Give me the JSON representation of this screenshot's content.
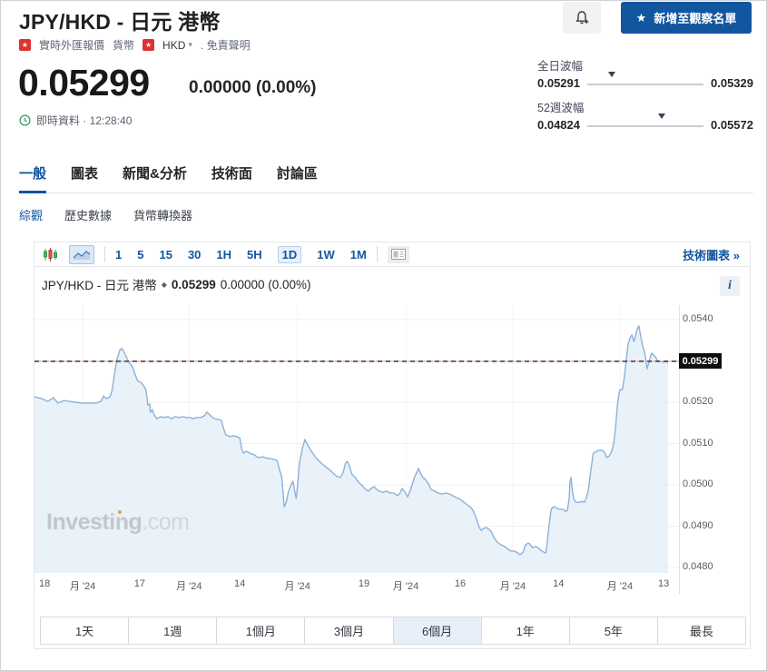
{
  "page": {
    "header": {
      "title": "JPY/HKD - 日元 港幣",
      "star": "★",
      "watchlist_label": "新增至觀察名單"
    },
    "breadcrumb": {
      "flag1": "★",
      "item1": "實時外匯報價",
      "item2": "貨幣",
      "flag2": "★",
      "pair": "HKD",
      "caret": "▾",
      "disclaimer": ". 免責聲明"
    },
    "quote": {
      "price": "0.05299",
      "change": "0.00000 (0.00%)",
      "realtime": "即時資料 · 12:28:40"
    },
    "ranges": {
      "day": {
        "label": "全日波幅",
        "low": "0.05291",
        "high": "0.05329",
        "pos": 0.21
      },
      "year": {
        "label": "52週波幅",
        "low": "0.04824",
        "high": "0.05572",
        "pos": 0.64
      }
    },
    "tabs": {
      "t0": "一般",
      "t1": "圖表",
      "t2": "新聞&分析",
      "t3": "技術面",
      "t4": "討論區"
    },
    "subnav": {
      "s0": "綜觀",
      "s1": "歷史數據",
      "s2": "貨幣轉換器"
    },
    "toolbar": {
      "i0": "1",
      "i1": "5",
      "i2": "15",
      "i3": "30",
      "i4": "1H",
      "i5": "5H",
      "i6": "1D",
      "i7": "1W",
      "i8": "1M",
      "link": "技術圖表 »"
    },
    "chart_header": {
      "name": "JPY/HKD - 日元 港幣",
      "diamond": "◆",
      "price": "0.05299",
      "change": "0.00000 (0.00%)",
      "info": "i"
    },
    "watermark": {
      "bold": "Investing",
      "light": ".com"
    },
    "footer": {
      "b0": "1天",
      "b1": "1週",
      "b2": "1個月",
      "b3": "3個月",
      "b4": "6個月",
      "b5": "1年",
      "b6": "5年",
      "b7": "最長"
    }
  },
  "colors": {
    "accent": "#1256a0",
    "line": "#8cb2d7",
    "fill": "#e7f0f8",
    "grid_h": "#eff1f2",
    "grid_v": "#f4f5f6",
    "dash_base": "#f2a5a5",
    "dash": "#2a2a2a",
    "badge_bg": "#0d0e10",
    "up_green": "#35a04c",
    "down_red": "#d23f3f"
  },
  "chart_data": {
    "type": "area",
    "title": "JPY/HKD 1D (6個月)",
    "ylabel": "",
    "xlabel": "",
    "ylim": [
      0.04787,
      0.05435
    ],
    "current_price": 0.05299,
    "current_price_label": "0.05299",
    "y_ticks": [
      {
        "v": 0.054,
        "label": "0.0540"
      },
      {
        "v": 0.053,
        "label": "0.0530"
      },
      {
        "v": 0.052,
        "label": "0.0520"
      },
      {
        "v": 0.051,
        "label": "0.0510"
      },
      {
        "v": 0.05,
        "label": "0.0500"
      },
      {
        "v": 0.049,
        "label": "0.0490"
      },
      {
        "v": 0.048,
        "label": "0.0480"
      }
    ],
    "x_ticks": [
      {
        "f": 0.016,
        "label": "18",
        "month": false
      },
      {
        "f": 0.076,
        "label": "月 '24",
        "month": true
      },
      {
        "f": 0.166,
        "label": "17",
        "month": false
      },
      {
        "f": 0.244,
        "label": "月 '24",
        "month": true
      },
      {
        "f": 0.324,
        "label": "14",
        "month": false
      },
      {
        "f": 0.415,
        "label": "月 '24",
        "month": true
      },
      {
        "f": 0.52,
        "label": "19",
        "month": false
      },
      {
        "f": 0.586,
        "label": "月 '24",
        "month": true
      },
      {
        "f": 0.672,
        "label": "16",
        "month": false
      },
      {
        "f": 0.755,
        "label": "月 '24",
        "month": true
      },
      {
        "f": 0.827,
        "label": "14",
        "month": false
      },
      {
        "f": 0.924,
        "label": "月 '24",
        "month": true
      },
      {
        "f": 0.993,
        "label": "13",
        "month": false
      }
    ],
    "points": [
      [
        0.0,
        0.05213
      ],
      [
        0.011,
        0.05209
      ],
      [
        0.021,
        0.05202
      ],
      [
        0.03,
        0.05211
      ],
      [
        0.037,
        0.05198
      ],
      [
        0.047,
        0.05204
      ],
      [
        0.056,
        0.05202
      ],
      [
        0.064,
        0.052
      ],
      [
        0.076,
        0.05198
      ],
      [
        0.087,
        0.05198
      ],
      [
        0.097,
        0.05198
      ],
      [
        0.105,
        0.05202
      ],
      [
        0.109,
        0.05215
      ],
      [
        0.113,
        0.05209
      ],
      [
        0.119,
        0.05213
      ],
      [
        0.122,
        0.05226
      ],
      [
        0.126,
        0.05264
      ],
      [
        0.13,
        0.05303
      ],
      [
        0.135,
        0.05327
      ],
      [
        0.138,
        0.0533
      ],
      [
        0.142,
        0.05319
      ],
      [
        0.146,
        0.05306
      ],
      [
        0.15,
        0.05295
      ],
      [
        0.155,
        0.05284
      ],
      [
        0.159,
        0.05266
      ],
      [
        0.163,
        0.05251
      ],
      [
        0.168,
        0.05248
      ],
      [
        0.172,
        0.0524
      ],
      [
        0.176,
        0.05231
      ],
      [
        0.179,
        0.05193
      ],
      [
        0.182,
        0.05196
      ],
      [
        0.183,
        0.05176
      ],
      [
        0.186,
        0.05182
      ],
      [
        0.189,
        0.05169
      ],
      [
        0.193,
        0.0516
      ],
      [
        0.199,
        0.05165
      ],
      [
        0.205,
        0.05163
      ],
      [
        0.211,
        0.05165
      ],
      [
        0.216,
        0.0516
      ],
      [
        0.222,
        0.05165
      ],
      [
        0.228,
        0.05163
      ],
      [
        0.234,
        0.05165
      ],
      [
        0.239,
        0.05163
      ],
      [
        0.245,
        0.05163
      ],
      [
        0.251,
        0.0516
      ],
      [
        0.256,
        0.05163
      ],
      [
        0.262,
        0.05163
      ],
      [
        0.268,
        0.05167
      ],
      [
        0.272,
        0.05176
      ],
      [
        0.277,
        0.05169
      ],
      [
        0.281,
        0.05163
      ],
      [
        0.285,
        0.0516
      ],
      [
        0.291,
        0.05158
      ],
      [
        0.295,
        0.05156
      ],
      [
        0.298,
        0.05138
      ],
      [
        0.302,
        0.05121
      ],
      [
        0.308,
        0.05117
      ],
      [
        0.314,
        0.05119
      ],
      [
        0.319,
        0.05117
      ],
      [
        0.324,
        0.05114
      ],
      [
        0.327,
        0.05088
      ],
      [
        0.33,
        0.05077
      ],
      [
        0.334,
        0.05081
      ],
      [
        0.338,
        0.05079
      ],
      [
        0.342,
        0.05075
      ],
      [
        0.347,
        0.05073
      ],
      [
        0.351,
        0.05068
      ],
      [
        0.355,
        0.05066
      ],
      [
        0.36,
        0.05068
      ],
      [
        0.364,
        0.05066
      ],
      [
        0.368,
        0.05064
      ],
      [
        0.372,
        0.05064
      ],
      [
        0.377,
        0.05062
      ],
      [
        0.383,
        0.05059
      ],
      [
        0.387,
        0.05035
      ],
      [
        0.39,
        0.05022
      ],
      [
        0.393,
        0.04971
      ],
      [
        0.394,
        0.04947
      ],
      [
        0.397,
        0.04956
      ],
      [
        0.401,
        0.04985
      ],
      [
        0.405,
        0.05
      ],
      [
        0.408,
        0.05009
      ],
      [
        0.411,
        0.04982
      ],
      [
        0.413,
        0.04967
      ],
      [
        0.415,
        0.04996
      ],
      [
        0.418,
        0.05051
      ],
      [
        0.423,
        0.0509
      ],
      [
        0.427,
        0.0511
      ],
      [
        0.431,
        0.05097
      ],
      [
        0.436,
        0.05084
      ],
      [
        0.44,
        0.05075
      ],
      [
        0.444,
        0.05066
      ],
      [
        0.45,
        0.05057
      ],
      [
        0.456,
        0.05048
      ],
      [
        0.461,
        0.05042
      ],
      [
        0.467,
        0.05035
      ],
      [
        0.473,
        0.05026
      ],
      [
        0.478,
        0.0502
      ],
      [
        0.483,
        0.05018
      ],
      [
        0.487,
        0.05029
      ],
      [
        0.491,
        0.05053
      ],
      [
        0.494,
        0.05057
      ],
      [
        0.497,
        0.05046
      ],
      [
        0.501,
        0.05026
      ],
      [
        0.506,
        0.05018
      ],
      [
        0.511,
        0.05007
      ],
      [
        0.517,
        0.04998
      ],
      [
        0.523,
        0.04989
      ],
      [
        0.527,
        0.04985
      ],
      [
        0.531,
        0.04991
      ],
      [
        0.536,
        0.04996
      ],
      [
        0.54,
        0.04989
      ],
      [
        0.544,
        0.04985
      ],
      [
        0.55,
        0.04982
      ],
      [
        0.556,
        0.04985
      ],
      [
        0.562,
        0.0498
      ],
      [
        0.567,
        0.0498
      ],
      [
        0.573,
        0.04974
      ],
      [
        0.577,
        0.0498
      ],
      [
        0.58,
        0.04991
      ],
      [
        0.585,
        0.04982
      ],
      [
        0.589,
        0.04971
      ],
      [
        0.592,
        0.04982
      ],
      [
        0.596,
        0.05
      ],
      [
        0.6,
        0.0502
      ],
      [
        0.605,
        0.05035
      ],
      [
        0.606,
        0.0504
      ],
      [
        0.609,
        0.05029
      ],
      [
        0.613,
        0.05018
      ],
      [
        0.617,
        0.05013
      ],
      [
        0.622,
        0.05002
      ],
      [
        0.626,
        0.04989
      ],
      [
        0.632,
        0.04985
      ],
      [
        0.637,
        0.0498
      ],
      [
        0.643,
        0.04978
      ],
      [
        0.649,
        0.0498
      ],
      [
        0.655,
        0.04978
      ],
      [
        0.66,
        0.04974
      ],
      [
        0.666,
        0.04969
      ],
      [
        0.672,
        0.04965
      ],
      [
        0.678,
        0.04958
      ],
      [
        0.683,
        0.04952
      ],
      [
        0.689,
        0.04945
      ],
      [
        0.693,
        0.04936
      ],
      [
        0.698,
        0.04916
      ],
      [
        0.702,
        0.04897
      ],
      [
        0.705,
        0.0489
      ],
      [
        0.709,
        0.04895
      ],
      [
        0.713,
        0.04897
      ],
      [
        0.718,
        0.04892
      ],
      [
        0.722,
        0.04884
      ],
      [
        0.726,
        0.0487
      ],
      [
        0.731,
        0.04861
      ],
      [
        0.736,
        0.04855
      ],
      [
        0.742,
        0.04851
      ],
      [
        0.748,
        0.04844
      ],
      [
        0.752,
        0.0484
      ],
      [
        0.756,
        0.0484
      ],
      [
        0.761,
        0.04837
      ],
      [
        0.765,
        0.04833
      ],
      [
        0.766,
        0.04831
      ],
      [
        0.771,
        0.04837
      ],
      [
        0.775,
        0.04855
      ],
      [
        0.779,
        0.04859
      ],
      [
        0.782,
        0.04857
      ],
      [
        0.786,
        0.04848
      ],
      [
        0.791,
        0.04851
      ],
      [
        0.795,
        0.04848
      ],
      [
        0.799,
        0.04842
      ],
      [
        0.804,
        0.04837
      ],
      [
        0.807,
        0.04835
      ],
      [
        0.809,
        0.04857
      ],
      [
        0.812,
        0.04901
      ],
      [
        0.815,
        0.04936
      ],
      [
        0.817,
        0.04945
      ],
      [
        0.821,
        0.04947
      ],
      [
        0.825,
        0.04943
      ],
      [
        0.829,
        0.04941
      ],
      [
        0.834,
        0.04941
      ],
      [
        0.838,
        0.04936
      ],
      [
        0.841,
        0.04938
      ],
      [
        0.844,
        0.04967
      ],
      [
        0.845,
        0.05007
      ],
      [
        0.847,
        0.05018
      ],
      [
        0.849,
        0.04985
      ],
      [
        0.852,
        0.04963
      ],
      [
        0.855,
        0.04958
      ],
      [
        0.86,
        0.04958
      ],
      [
        0.864,
        0.0496
      ],
      [
        0.868,
        0.04958
      ],
      [
        0.871,
        0.04969
      ],
      [
        0.874,
        0.04987
      ],
      [
        0.878,
        0.05033
      ],
      [
        0.882,
        0.05077
      ],
      [
        0.887,
        0.05081
      ],
      [
        0.891,
        0.05084
      ],
      [
        0.895,
        0.05084
      ],
      [
        0.9,
        0.05079
      ],
      [
        0.903,
        0.05066
      ],
      [
        0.907,
        0.0507
      ],
      [
        0.911,
        0.05081
      ],
      [
        0.914,
        0.05099
      ],
      [
        0.917,
        0.05138
      ],
      [
        0.92,
        0.05193
      ],
      [
        0.923,
        0.05226
      ],
      [
        0.925,
        0.05231
      ],
      [
        0.928,
        0.05231
      ],
      [
        0.931,
        0.05259
      ],
      [
        0.934,
        0.05301
      ],
      [
        0.937,
        0.05341
      ],
      [
        0.94,
        0.05356
      ],
      [
        0.943,
        0.05363
      ],
      [
        0.946,
        0.05347
      ],
      [
        0.948,
        0.05356
      ],
      [
        0.951,
        0.05376
      ],
      [
        0.954,
        0.05385
      ],
      [
        0.957,
        0.05358
      ],
      [
        0.96,
        0.05336
      ],
      [
        0.963,
        0.05321
      ],
      [
        0.966,
        0.05292
      ],
      [
        0.967,
        0.05281
      ],
      [
        0.97,
        0.05299
      ],
      [
        0.973,
        0.05314
      ],
      [
        0.974,
        0.05319
      ],
      [
        0.977,
        0.05314
      ],
      [
        0.98,
        0.0531
      ],
      [
        0.983,
        0.05301
      ],
      [
        0.987,
        0.05299
      ],
      [
        0.991,
        0.05297
      ],
      [
        0.996,
        0.05299
      ],
      [
        1.0,
        0.05297
      ]
    ]
  }
}
